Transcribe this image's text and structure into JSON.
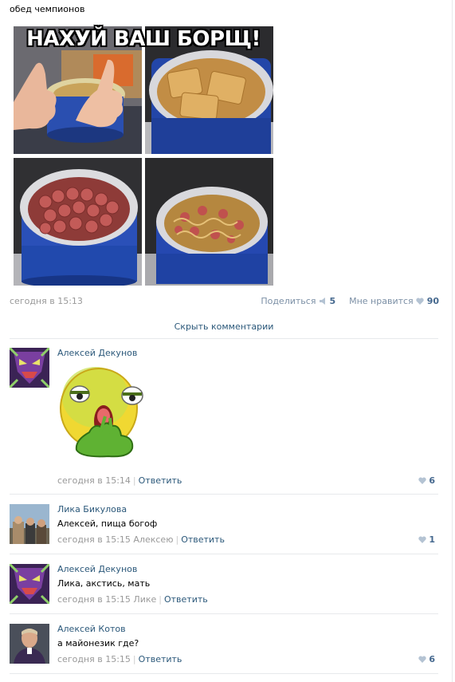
{
  "post": {
    "text": "обед чемпионов",
    "photo_caption": "НАХУЙ ВАШ БОРЩ!",
    "date": "сегодня в 15:13",
    "share_label": "Поделиться",
    "share_count": "5",
    "like_label": "Мне нравится",
    "like_count": "90"
  },
  "hide_comments": "Скрыть комментарии",
  "reply_label": "Ответить",
  "comments": [
    {
      "author": "Алексей Декунов",
      "text": "",
      "time": "сегодня в 15:14",
      "reply_to": "",
      "likes": "6",
      "sticker": "disgusted-smiley-sticker"
    },
    {
      "author": "Лика Бикулова",
      "text": "Алексей, пища богоф",
      "time": "сегодня в 15:15",
      "reply_to": "Алексею",
      "likes": "1"
    },
    {
      "author": "Алексей Декунов",
      "text": "Лика, акстись, мать",
      "time": "сегодня в 15:15",
      "reply_to": "Лике",
      "likes": ""
    },
    {
      "author": "Алексей Котов",
      "text": "а майонезик где?",
      "time": "сегодня в 15:15",
      "reply_to": "",
      "likes": "6"
    }
  ],
  "colors": {
    "link": "#2b587a",
    "muted": "#999999",
    "like": "#45688e",
    "pot_blue": "#1f45a6"
  }
}
